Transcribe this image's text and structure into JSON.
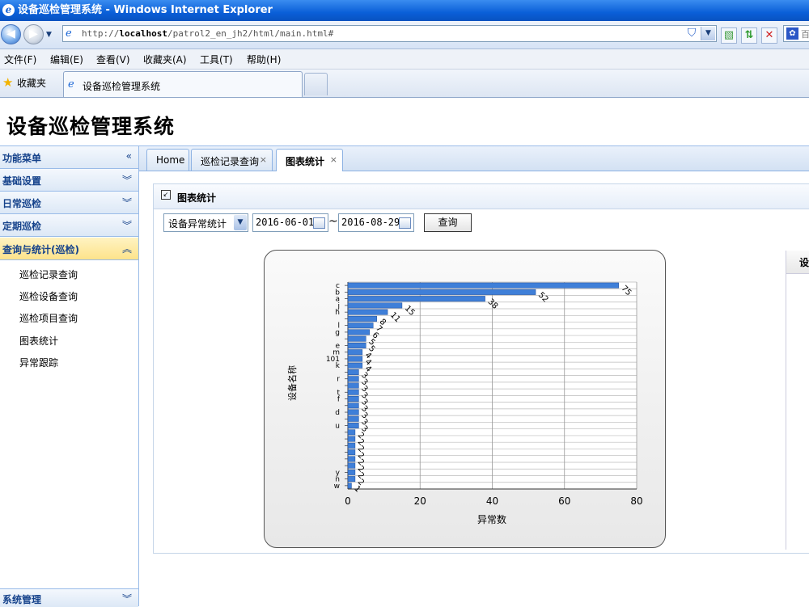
{
  "window": {
    "title": "设备巡检管理系统 - Windows Internet Explorer",
    "url_prefix": "http://",
    "url_host": "localhost",
    "url_path": "/patrol2_en_jh2/html/main.html#",
    "search_text": "百"
  },
  "menu": [
    "文件(F)",
    "编辑(E)",
    "查看(V)",
    "收藏夹(A)",
    "工具(T)",
    "帮助(H)"
  ],
  "favorites": {
    "label": "收藏夹",
    "tab_title": "设备巡检管理系统"
  },
  "app": {
    "title": "设备巡检管理系统"
  },
  "sidebar": {
    "header": "功能菜单",
    "groups": [
      "基础设置",
      "日常巡检",
      "定期巡检",
      "查询与统计(巡检)"
    ],
    "active_group": "查询与统计(巡检)",
    "sub_items": [
      "巡检记录查询",
      "巡检设备查询",
      "巡检项目查询",
      "图表统计",
      "异常跟踪"
    ],
    "bottom": "系统管理"
  },
  "tabs": [
    {
      "label": "Home",
      "closable": false
    },
    {
      "label": "巡检记录查询",
      "closable": true
    },
    {
      "label": "图表统计",
      "closable": true,
      "active": true
    }
  ],
  "panel": {
    "title": "图表统计",
    "select_value": "设备异常统计",
    "date_from": "2016-06-01",
    "tilde": "~",
    "date_to": "2016-08-29",
    "query_label": "查询"
  },
  "right_table": {
    "header": "设"
  },
  "chart_data": {
    "type": "bar",
    "orientation": "horizontal",
    "ylabel": "设备名称",
    "xlabel": "异常数",
    "xlim": [
      0,
      80
    ],
    "xticks": [
      0,
      20,
      40,
      60,
      80
    ],
    "grid": true,
    "categories": [
      "c",
      "b",
      "a",
      "j",
      "h",
      "",
      "l",
      "g",
      "",
      "e",
      "m",
      "101",
      "k",
      "",
      "r",
      "",
      "t",
      "f",
      "",
      "d",
      "",
      "u",
      "",
      "",
      "",
      "",
      "",
      "",
      "y",
      "n",
      "w"
    ],
    "values": [
      75,
      52,
      38,
      15,
      11,
      8,
      7,
      6,
      5,
      5,
      4,
      4,
      4,
      3,
      3,
      3,
      3,
      3,
      3,
      3,
      3,
      3,
      2,
      2,
      2,
      2,
      2,
      2,
      2,
      2,
      1
    ],
    "colors": {
      "bar": "#3f7fd8",
      "bar_edge": "#1f4e9a"
    }
  }
}
